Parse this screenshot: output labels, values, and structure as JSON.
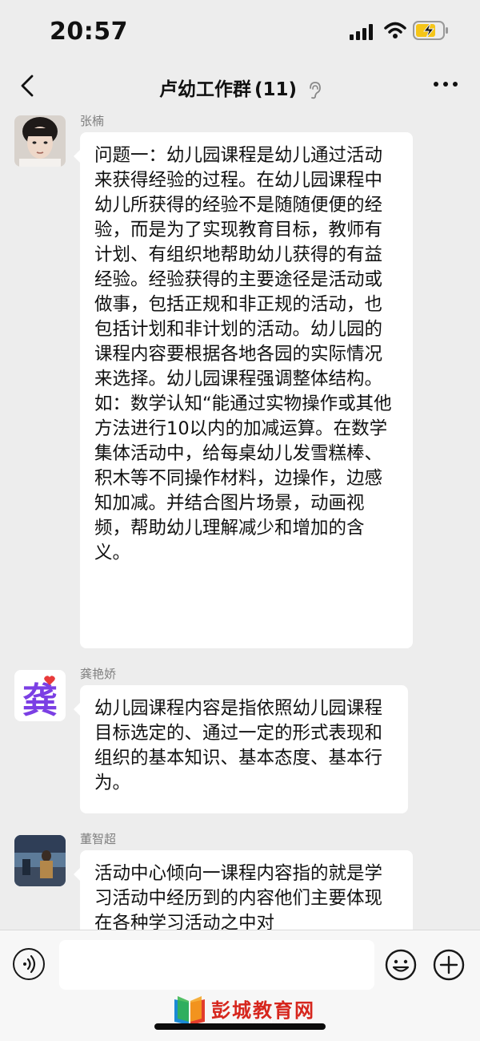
{
  "status": {
    "time": "20:57"
  },
  "nav": {
    "title": "卢幼工作群",
    "member_count": "(11)"
  },
  "messages": [
    {
      "sender": "张楠",
      "text": "问题一：幼儿园课程是幼儿通过活动来获得经验的过程。在幼儿园课程中幼儿所获得的经验不是随随便便的经验，而是为了实现教育目标，教师有计划、有组织地帮助幼儿获得的有益经验。经验获得的主要途径是活动或做事，包括正规和非正规的活动，也包括计划和非计划的活动。幼儿园的课程内容要根据各地各园的实际情况来选择。幼儿园课程强调整体结构。如：数学认知“能通过实物操作或其他方法进行10以内的加减运算。在数学集体活动中，给每桌幼儿发雪糕棒、积木等不同操作材料，边操作，边感知加减。并结合图片场景，动画视频，帮助幼儿理解减少和增加的含义。"
    },
    {
      "sender": "龚艳娇",
      "avatar_text": "龚",
      "text": "幼儿园课程内容是指依照幼儿园课程目标选定的、通过一定的形式表现和组织的基本知识、基本态度、基本行为。"
    },
    {
      "sender": "董智超",
      "text": "活动中心倾向一课程内容指的就是学习活动中经历到的内容他们主要体现在各种学习活动之中对"
    }
  ],
  "input": {
    "placeholder": ""
  },
  "watermark": {
    "text": "彭城教育网",
    "url": "www.pcjyedu.cn"
  },
  "colors": {
    "background": "#ededed",
    "bubble": "#ffffff",
    "watermark": "#d6261d",
    "avatar2": "#7b3fe4"
  }
}
